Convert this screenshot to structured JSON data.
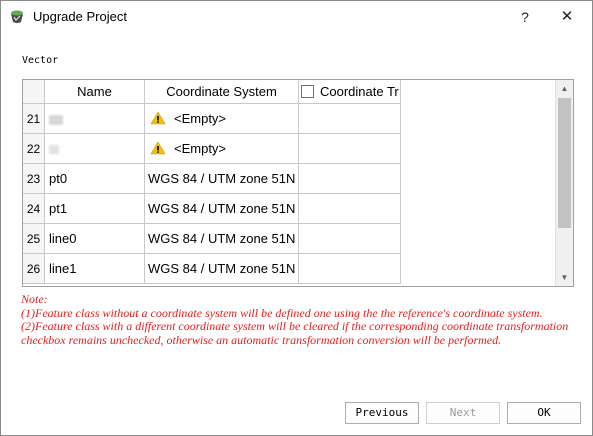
{
  "window": {
    "title": "Upgrade Project",
    "help_label": "?",
    "close_label": "✕",
    "icon": "app-logo-icon"
  },
  "section_label": "Vector",
  "table": {
    "columns": [
      "Name",
      "Coordinate System",
      "Coordinate Tr"
    ],
    "rows": [
      {
        "num": "21",
        "name": "",
        "name_blurred": true,
        "cs": "<Empty>",
        "warning": true
      },
      {
        "num": "22",
        "name": "",
        "name_blurred": true,
        "cs": "<Empty>",
        "warning": true
      },
      {
        "num": "23",
        "name": "pt0",
        "name_blurred": false,
        "cs": "WGS 84 / UTM zone 51N",
        "warning": false
      },
      {
        "num": "24",
        "name": "pt1",
        "name_blurred": false,
        "cs": "WGS 84 / UTM zone 51N",
        "warning": false
      },
      {
        "num": "25",
        "name": "line0",
        "name_blurred": false,
        "cs": "WGS 84 / UTM zone 51N",
        "warning": false
      },
      {
        "num": "26",
        "name": "line1",
        "name_blurred": false,
        "cs": "WGS 84 / UTM zone 51N",
        "warning": false
      }
    ]
  },
  "note": {
    "heading": "Note:",
    "line1": "(1)Feature class without a coordinate system will be defined one using the the reference's coordinate system.",
    "line2": "(2)Feature class with a different coordinate system will be cleared if the corresponding coordinate transformation checkbox remains unchecked, otherwise an automatic transformation conversion will be performed."
  },
  "buttons": {
    "previous": "Previous",
    "next": "Next",
    "ok": "OK"
  },
  "colors": {
    "note_text": "#e02020",
    "warning": "#f2c200",
    "disabled_text": "#9a9a9a"
  }
}
